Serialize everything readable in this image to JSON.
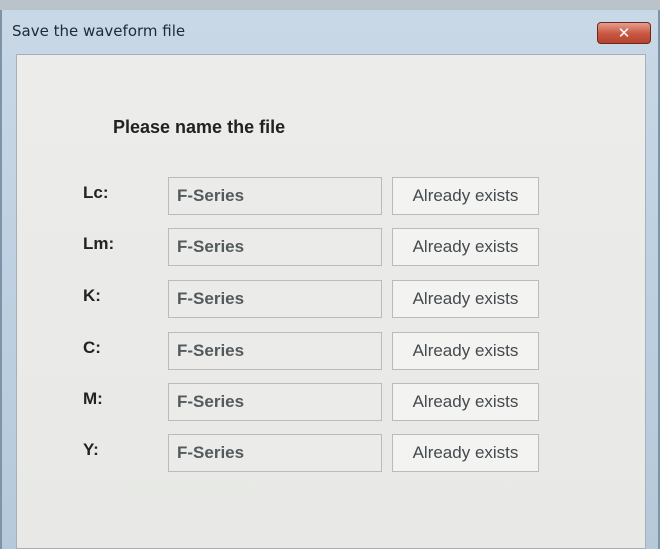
{
  "window": {
    "title": "Save the waveform file",
    "close_label": "✕"
  },
  "dialog": {
    "heading": "Please name the file",
    "rows": [
      {
        "label": "Lc:",
        "value": "F-Series",
        "status": "Already exists"
      },
      {
        "label": "Lm:",
        "value": "F-Series",
        "status": "Already exists"
      },
      {
        "label": "K:",
        "value": "F-Series",
        "status": "Already exists"
      },
      {
        "label": "C:",
        "value": "F-Series",
        "status": "Already exists"
      },
      {
        "label": "M:",
        "value": "F-Series",
        "status": "Already exists"
      },
      {
        "label": "Y:",
        "value": "F-Series",
        "status": "Already exists"
      }
    ]
  },
  "colors": {
    "title_bar": "#c9d8e6",
    "close_button": "#c8553f",
    "dialog_background": "#ecedea"
  }
}
